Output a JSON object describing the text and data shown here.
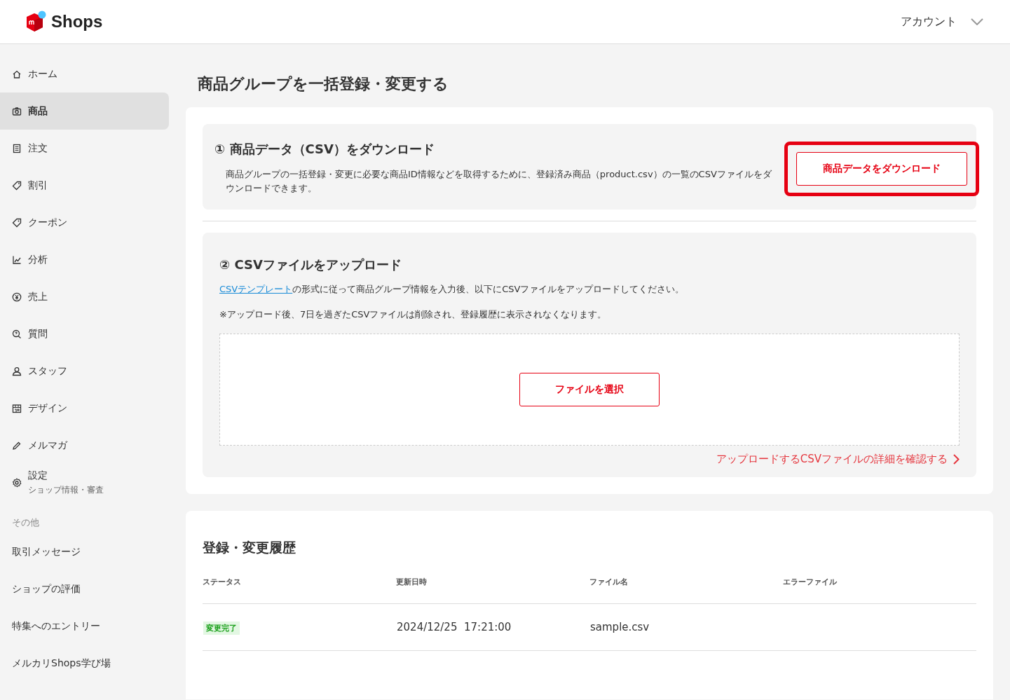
{
  "header": {
    "logo_text": "Shops",
    "account": "アカウント"
  },
  "sidebar": {
    "items": [
      {
        "label": "ホーム",
        "selected": false
      },
      {
        "label": "商品",
        "selected": true
      },
      {
        "label": "注文",
        "selected": false
      },
      {
        "label": "割引",
        "selected": false
      },
      {
        "label": "クーポン",
        "selected": false
      },
      {
        "label": "分析",
        "selected": false
      },
      {
        "label": "売上",
        "selected": false
      },
      {
        "label": "質問",
        "selected": false
      },
      {
        "label": "スタッフ",
        "selected": false
      },
      {
        "label": "デザイン",
        "selected": false
      },
      {
        "label": "メルマガ",
        "selected": false
      },
      {
        "label": "設定",
        "sublabel": "ショップ情報・審査",
        "selected": false
      }
    ],
    "other_heading": "その他",
    "other_items": [
      {
        "label": "取引メッセージ"
      },
      {
        "label": "ショップの評価"
      },
      {
        "label": "特集へのエントリー"
      },
      {
        "label": "メルカリShops学び場"
      }
    ]
  },
  "page_title": "商品グループを一括登録・変更する",
  "download_section": {
    "heading": "① 商品データ（CSV）をダウンロード",
    "description": "商品グループの一括登録・変更に必要な商品ID情報などを取得するために、登録済み商品（product.csv）の一覧のCSVファイルをダウンロードできます。",
    "button": "商品データをダウンロード",
    "highlighted": true
  },
  "upload_section": {
    "heading": "② CSVファイルをアップロード",
    "template_link": "CSVテンプレート",
    "instruction": "の形式に従って商品グループ情報を入力後、以下にCSVファイルをアップロードしてください。",
    "note": "※アップロード後、7日を過ぎたCSVファイルは削除され、登録履歴に表示されなくなります。",
    "select_button": "ファイルを選択",
    "details_link": "アップロードするCSVファイルの詳細を確認する"
  },
  "history": {
    "heading": "登録・変更履歴",
    "columns": [
      "ステータス",
      "更新日時",
      "ファイル名",
      "エラーファイル"
    ],
    "rows": [
      {
        "status": "変更完了",
        "updated": "2024/12/25  17:21:00",
        "file": "sample.csv"
      }
    ]
  }
}
